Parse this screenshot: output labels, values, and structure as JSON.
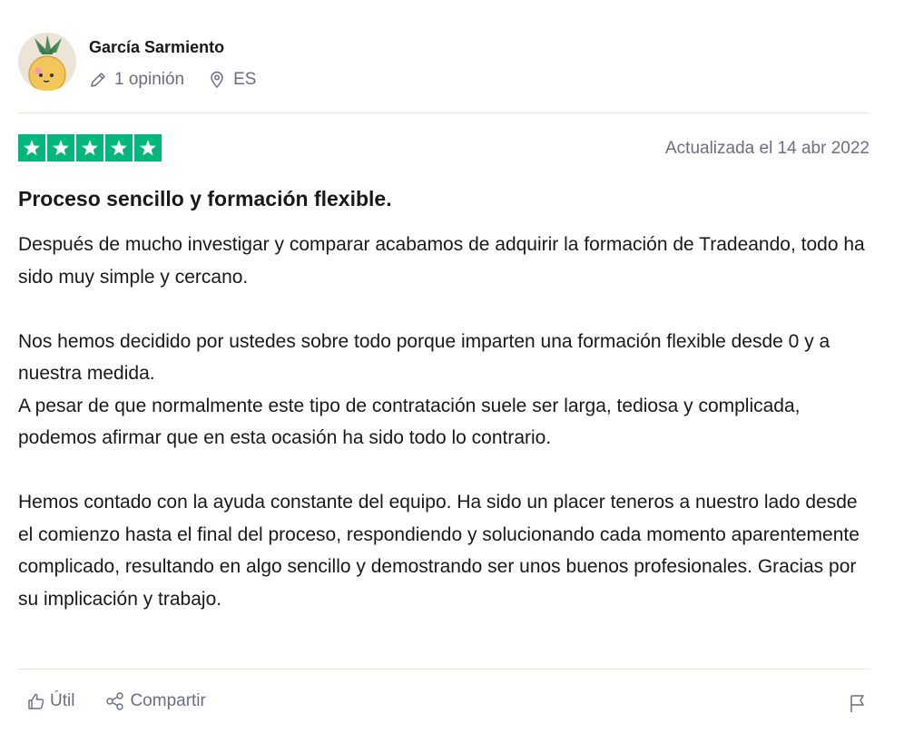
{
  "review": {
    "consumer": {
      "name": "García Sarmiento",
      "reviews_count": "1 opinión",
      "country": "ES"
    },
    "rating": 5,
    "star_color": "#00b67a",
    "date": "Actualizada el 14 abr 2022",
    "title": "Proceso sencillo y formación flexible.",
    "paragraphs": [
      "Después de mucho investigar y comparar acabamos de adquirir la formación de Tradeando, todo ha sido muy simple y cercano.",
      "Nos hemos decidido por ustedes sobre todo porque imparten una formación flexible desde 0 y a nuestra medida.\nA pesar de que normalmente este tipo de contratación suele ser larga, tediosa y complicada, podemos afirmar que en esta ocasión ha sido todo lo contrario.",
      "Hemos contado con la ayuda constante del equipo. Ha sido un placer teneros a nuestro lado desde el comienzo hasta el final del proceso, respondiendo y solucionando cada momento aparentemente complicado, resultando en algo sencillo y demostrando ser unos buenos profesionales. Gracias por su implicación y trabajo."
    ],
    "actions": {
      "useful_label": "Útil",
      "share_label": "Compartir"
    },
    "icons": {
      "pencil": "pencil-icon",
      "location": "location-pin-icon",
      "star": "star-icon",
      "thumbs_up": "thumbs-up-icon",
      "share": "share-icon",
      "flag": "flag-icon"
    }
  }
}
